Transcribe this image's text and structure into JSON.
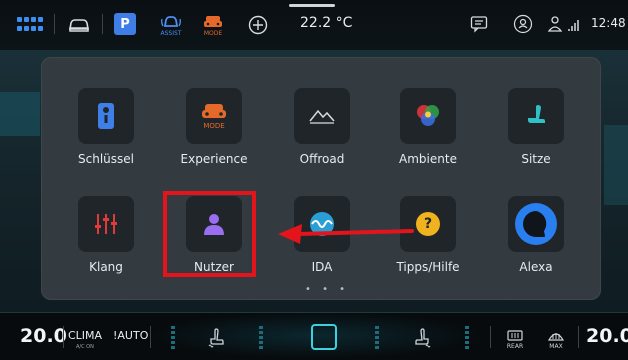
{
  "status_bar": {
    "temperature": "22.2 °C",
    "time": "12:48",
    "icons": [
      "apps-grid-icon",
      "car-icon",
      "parking-icon",
      "assist-icon",
      "mode-icon",
      "add-icon",
      "message-icon",
      "profile-icon",
      "user-signal-icon"
    ],
    "assist_label": "ASSIST",
    "mode_label": "MODE",
    "parking_label": "P"
  },
  "menu": {
    "tiles": [
      {
        "label": "Schlüssel",
        "icon": "key-icon"
      },
      {
        "label": "Experience",
        "icon": "experience-icon",
        "sublabel": "MODE"
      },
      {
        "label": "Offroad",
        "icon": "mountain-icon"
      },
      {
        "label": "Ambiente",
        "icon": "color-wheel-icon"
      },
      {
        "label": "Sitze",
        "icon": "seat-icon"
      },
      {
        "label": "Klang",
        "icon": "equalizer-icon"
      },
      {
        "label": "Nutzer",
        "icon": "user-icon"
      },
      {
        "label": "IDA",
        "icon": "ida-wave-icon"
      },
      {
        "label": "Tipps/Hilfe",
        "icon": "help-icon",
        "symbol": "?"
      },
      {
        "label": "Alexa",
        "icon": "alexa-icon"
      }
    ],
    "page_indicator": "• • •",
    "highlight_color": "#e3141b"
  },
  "climate_bar": {
    "left_temp": "20.0",
    "right_temp": "20.0",
    "clima_label": "CLIMA",
    "clima_sub": "A/C ON",
    "auto_label": "!AUTO",
    "rear_label": "REAR",
    "max_label": "MAX"
  }
}
